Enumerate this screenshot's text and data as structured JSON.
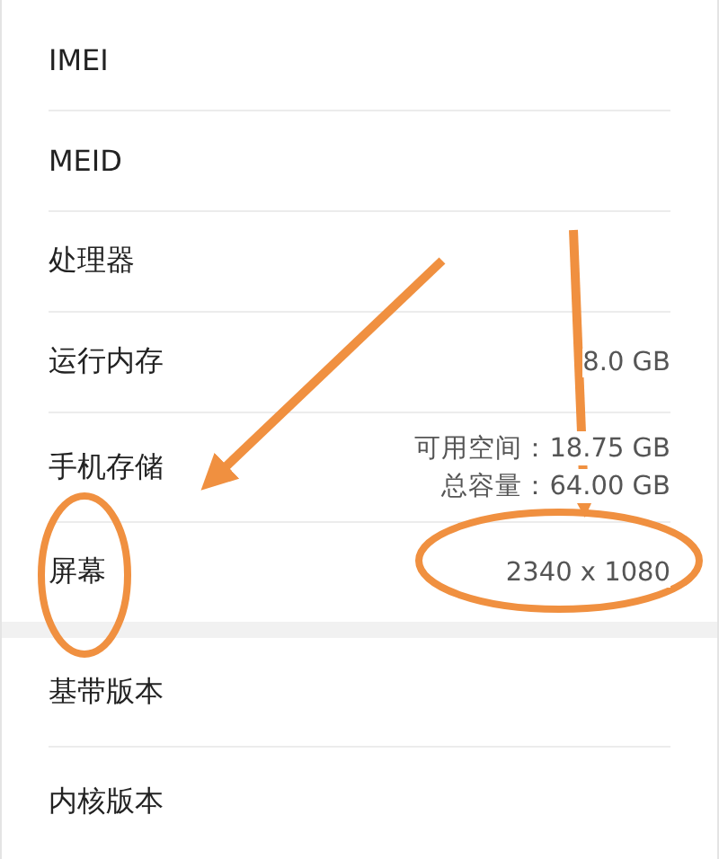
{
  "sections": [
    {
      "rows": [
        {
          "label": "IMEI"
        },
        {
          "label": "MEID"
        },
        {
          "label": "处理器"
        },
        {
          "label": "运行内存",
          "values": [
            "8.0 GB"
          ]
        },
        {
          "label": "手机存储",
          "values": [
            "可用空间：18.75 GB",
            "总容量：64.00 GB"
          ]
        },
        {
          "label": "屏幕",
          "values": [
            "2340 x 1080"
          ]
        }
      ]
    },
    {
      "rows": [
        {
          "label": "基带版本"
        },
        {
          "label": "内核版本"
        }
      ]
    }
  ]
}
